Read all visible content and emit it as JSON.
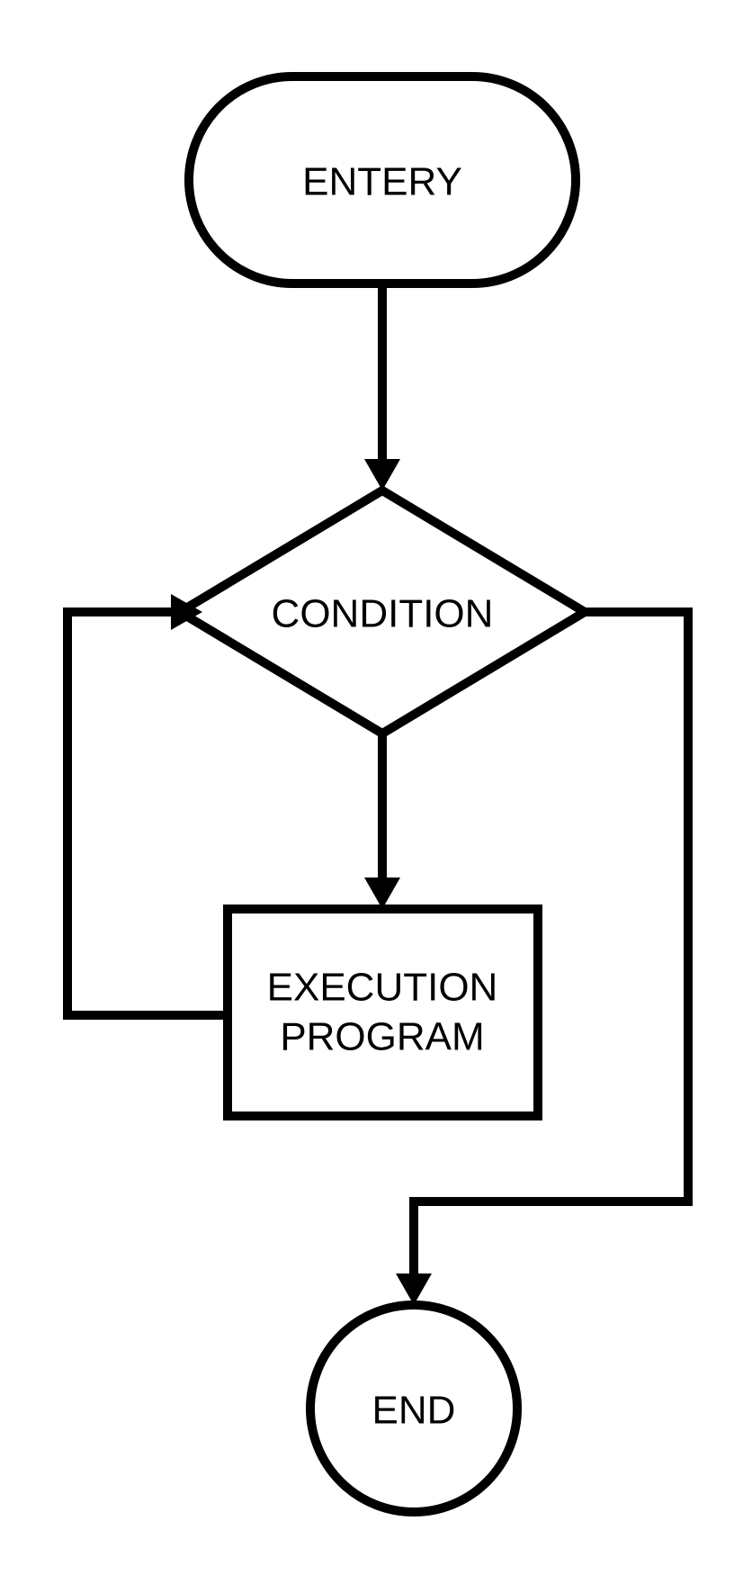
{
  "flowchart": {
    "nodes": {
      "entry": {
        "label": "ENTERY",
        "shape": "terminator"
      },
      "condition": {
        "label": "CONDITION",
        "shape": "decision"
      },
      "exec_line1": "EXECUTION",
      "exec_line2": "PROGRAM",
      "end": {
        "label": "END",
        "shape": "terminator-circle"
      }
    },
    "edges": [
      {
        "from": "entry",
        "to": "condition"
      },
      {
        "from": "condition",
        "to": "execution",
        "direction": "down"
      },
      {
        "from": "execution",
        "to": "condition",
        "direction": "loop-left"
      },
      {
        "from": "condition",
        "to": "end",
        "direction": "right-down"
      }
    ]
  }
}
